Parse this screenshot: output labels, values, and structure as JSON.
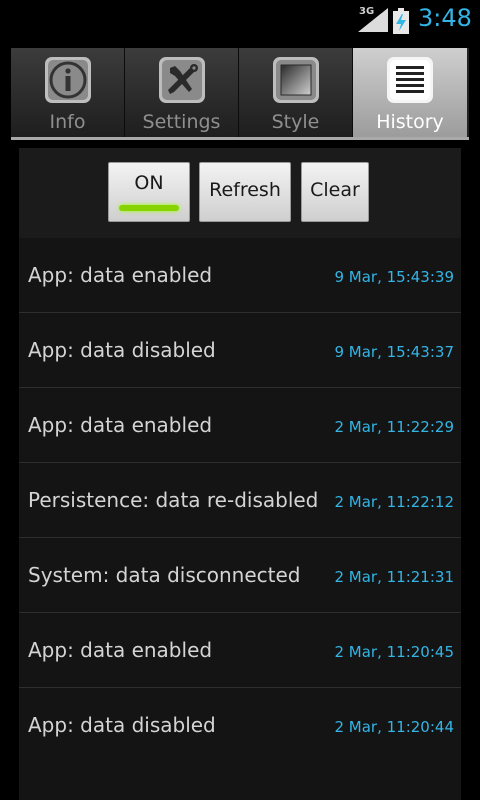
{
  "status_bar": {
    "network_type": "3G",
    "clock": "3:48",
    "icons": [
      "signal-icon",
      "battery-charging-icon"
    ]
  },
  "tabs": [
    {
      "label": "Info",
      "icon": "info-icon",
      "active": false
    },
    {
      "label": "Settings",
      "icon": "tools-icon",
      "active": false
    },
    {
      "label": "Style",
      "icon": "style-icon",
      "active": false
    },
    {
      "label": "History",
      "icon": "history-list-icon",
      "active": true
    }
  ],
  "toolbar": {
    "toggle_label": "ON",
    "toggle_state": "on",
    "refresh_label": "Refresh",
    "clear_label": "Clear"
  },
  "history": [
    {
      "event": "App: data enabled",
      "time": "9 Mar, 15:43:39"
    },
    {
      "event": "App: data disabled",
      "time": "9 Mar, 15:43:37"
    },
    {
      "event": "App: data enabled",
      "time": "2 Mar, 11:22:29"
    },
    {
      "event": "Persistence: data re-disabled",
      "time": "2 Mar, 11:22:12"
    },
    {
      "event": "System: data disconnected",
      "time": "2 Mar, 11:21:31"
    },
    {
      "event": "App: data enabled",
      "time": "2 Mar, 11:20:45"
    },
    {
      "event": "App: data disabled",
      "time": "2 Mar, 11:20:44"
    }
  ],
  "colors": {
    "accent": "#33b5e5",
    "toggle_on": "#86d300",
    "background": "#000000",
    "panel": "#141414"
  }
}
